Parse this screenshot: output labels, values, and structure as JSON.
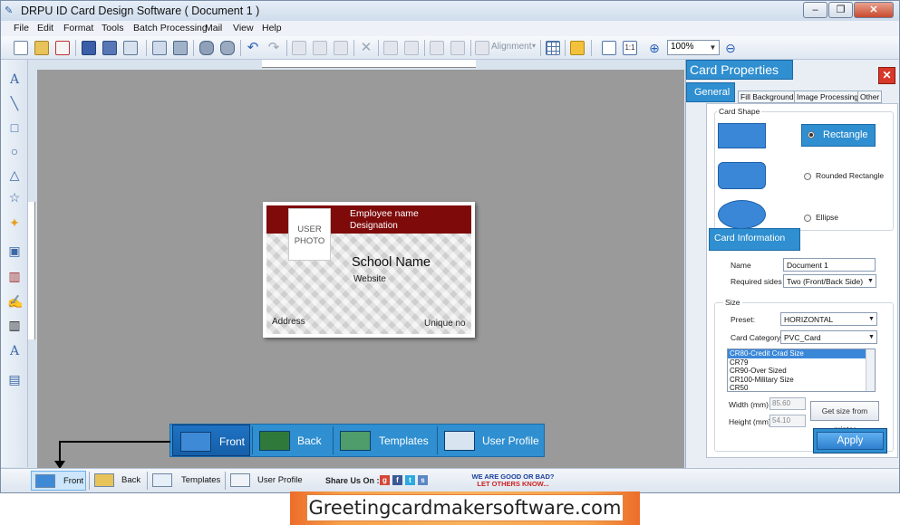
{
  "window": {
    "title": "DRPU ID Card Design Software ( Document 1 )",
    "controls": [
      "–",
      "❐",
      "✕"
    ]
  },
  "menu": [
    "File",
    "Edit",
    "Format",
    "Tools",
    "Batch Processing",
    "Mail",
    "View",
    "Help"
  ],
  "toolbar": {
    "alignment_label": "Alignment",
    "zoom_value": "100%",
    "zoom_ratio_label": "1:1"
  },
  "card": {
    "photo_line1": "USER",
    "photo_line2": "PHOTO",
    "employee_name": "Employee name",
    "designation": "Designation",
    "school_name": "School Name",
    "website": "Website",
    "address": "Address",
    "unique_no": "Unique no",
    "band_color": "#7e0a0a"
  },
  "big_tabs": [
    {
      "label": "Front",
      "active": true
    },
    {
      "label": "Back"
    },
    {
      "label": "Templates"
    },
    {
      "label": "User Profile"
    }
  ],
  "bottom_tabs": [
    {
      "label": "Front",
      "active": true
    },
    {
      "label": "Back"
    },
    {
      "label": "Templates"
    },
    {
      "label": "User Profile"
    }
  ],
  "share": {
    "label": "Share Us On :",
    "feedback_line1": "WE ARE GOOD OR BAD?",
    "feedback_line2": "LET OTHERS KNOW..."
  },
  "props": {
    "title": "Card Properties",
    "tabs": [
      "General",
      "Fill Background",
      "Image Processing",
      "Other"
    ],
    "card_shape_label": "Card Shape",
    "shapes": [
      {
        "label": "Rectangle",
        "selected": true
      },
      {
        "label": "Rounded Rectangle"
      },
      {
        "label": "Ellipse"
      }
    ],
    "card_info_label": "Card Information",
    "name_label": "Name",
    "name_value": "Document 1",
    "sides_label": "Required sides",
    "sides_value": "Two (Front/Back Side)",
    "size_label": "Size",
    "preset_label": "Preset:",
    "preset_value": "HORIZONTAL",
    "category_label": "Card Category",
    "category_value": "PVC_Card",
    "size_options": [
      "CR80-Credit Crad Size",
      "CR79",
      "CR90-Over Sized",
      "CR100-Military Size",
      "CR50"
    ],
    "width_label": "Width  (mm)",
    "width_value": "85.60",
    "height_label": "Height (mm)",
    "height_value": "54.10",
    "get_size_label": "Get size from printer",
    "apply_label": "Apply"
  },
  "footer": {
    "text": "Greetingcardmakersoftware.com"
  },
  "colors": {
    "accent": "#2f8fd0",
    "canvas": "#9a9a9a"
  }
}
